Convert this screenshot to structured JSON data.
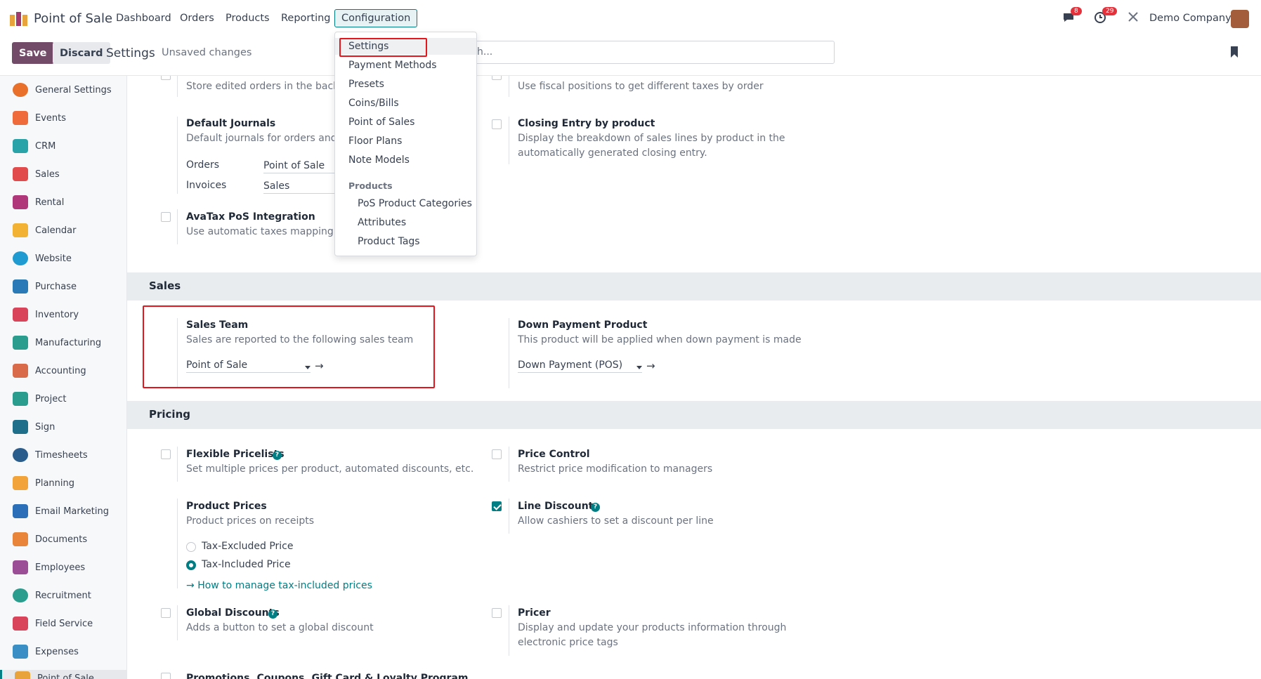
{
  "header": {
    "app_name": "Point of Sale",
    "nav": [
      "Dashboard",
      "Orders",
      "Products",
      "Reporting",
      "Configuration"
    ],
    "chat_badge": "8",
    "activity_badge": "29",
    "company": "Demo Company"
  },
  "control": {
    "save": "Save",
    "discard": "Discard",
    "title": "Settings",
    "status": "Unsaved changes",
    "search_placeholder": "h..."
  },
  "sidebar": {
    "items": [
      "General Settings",
      "Events",
      "CRM",
      "Sales",
      "Rental",
      "Calendar",
      "Website",
      "Purchase",
      "Inventory",
      "Manufacturing",
      "Accounting",
      "Project",
      "Sign",
      "Timesheets",
      "Planning",
      "Email Marketing",
      "Documents",
      "Employees",
      "Recruitment",
      "Field Service",
      "Expenses",
      "Point of Sale"
    ]
  },
  "dropdown": {
    "items": [
      "Settings",
      "Payment Methods",
      "Presets",
      "Coins/Bills",
      "Point of Sales",
      "Floor Plans",
      "Note Models"
    ],
    "section": "Products",
    "sub_items": [
      "PoS Product Categories",
      "Attributes",
      "Product Tags"
    ]
  },
  "top_section": {
    "store_desc": "Store edited orders in the backen",
    "fiscal_desc": "Use fiscal positions to get different taxes by order",
    "journals_title": "Default Journals",
    "journals_desc": "Default journals for orders and in",
    "orders_label": "Orders",
    "orders_value": "Point of Sale",
    "invoices_label": "Invoices",
    "invoices_value": "Sales",
    "closing_title": "Closing Entry by product",
    "closing_desc1": "Display the breakdown of sales lines by product in the",
    "closing_desc2": "automatically generated closing entry.",
    "avatax_title": "AvaTax PoS Integration",
    "avatax_desc": "Use automatic taxes mapping wit"
  },
  "sales": {
    "heading": "Sales",
    "team_title": "Sales Team",
    "team_desc": "Sales are reported to the following sales team",
    "team_value": "Point of Sale",
    "down_title": "Down Payment Product",
    "down_desc": "This product will be applied when down payment is made",
    "down_value": "Down Payment (POS)"
  },
  "pricing": {
    "heading": "Pricing",
    "flex_title": "Flexible Pricelists",
    "flex_desc": "Set multiple prices per product, automated discounts, etc.",
    "control_title": "Price Control",
    "control_desc": "Restrict price modification to managers",
    "prices_title": "Product Prices",
    "prices_desc": "Product prices on receipts",
    "tax_excl": "Tax-Excluded Price",
    "tax_incl": "Tax-Included Price",
    "tax_link": "How to manage tax-included prices",
    "line_title": "Line Discounts",
    "line_desc": "Allow cashiers to set a discount per line",
    "global_title": "Global Discounts",
    "global_desc": "Adds a button to set a global discount",
    "pricer_title": "Pricer",
    "pricer_desc1": "Display and update your products information through",
    "pricer_desc2": "electronic price tags",
    "promo_title": "Promotions, Coupons, Gift Card & Loyalty Program"
  },
  "colors": {
    "brand": "#714b67",
    "accent": "#017e84",
    "highlight": "#e3161e"
  }
}
